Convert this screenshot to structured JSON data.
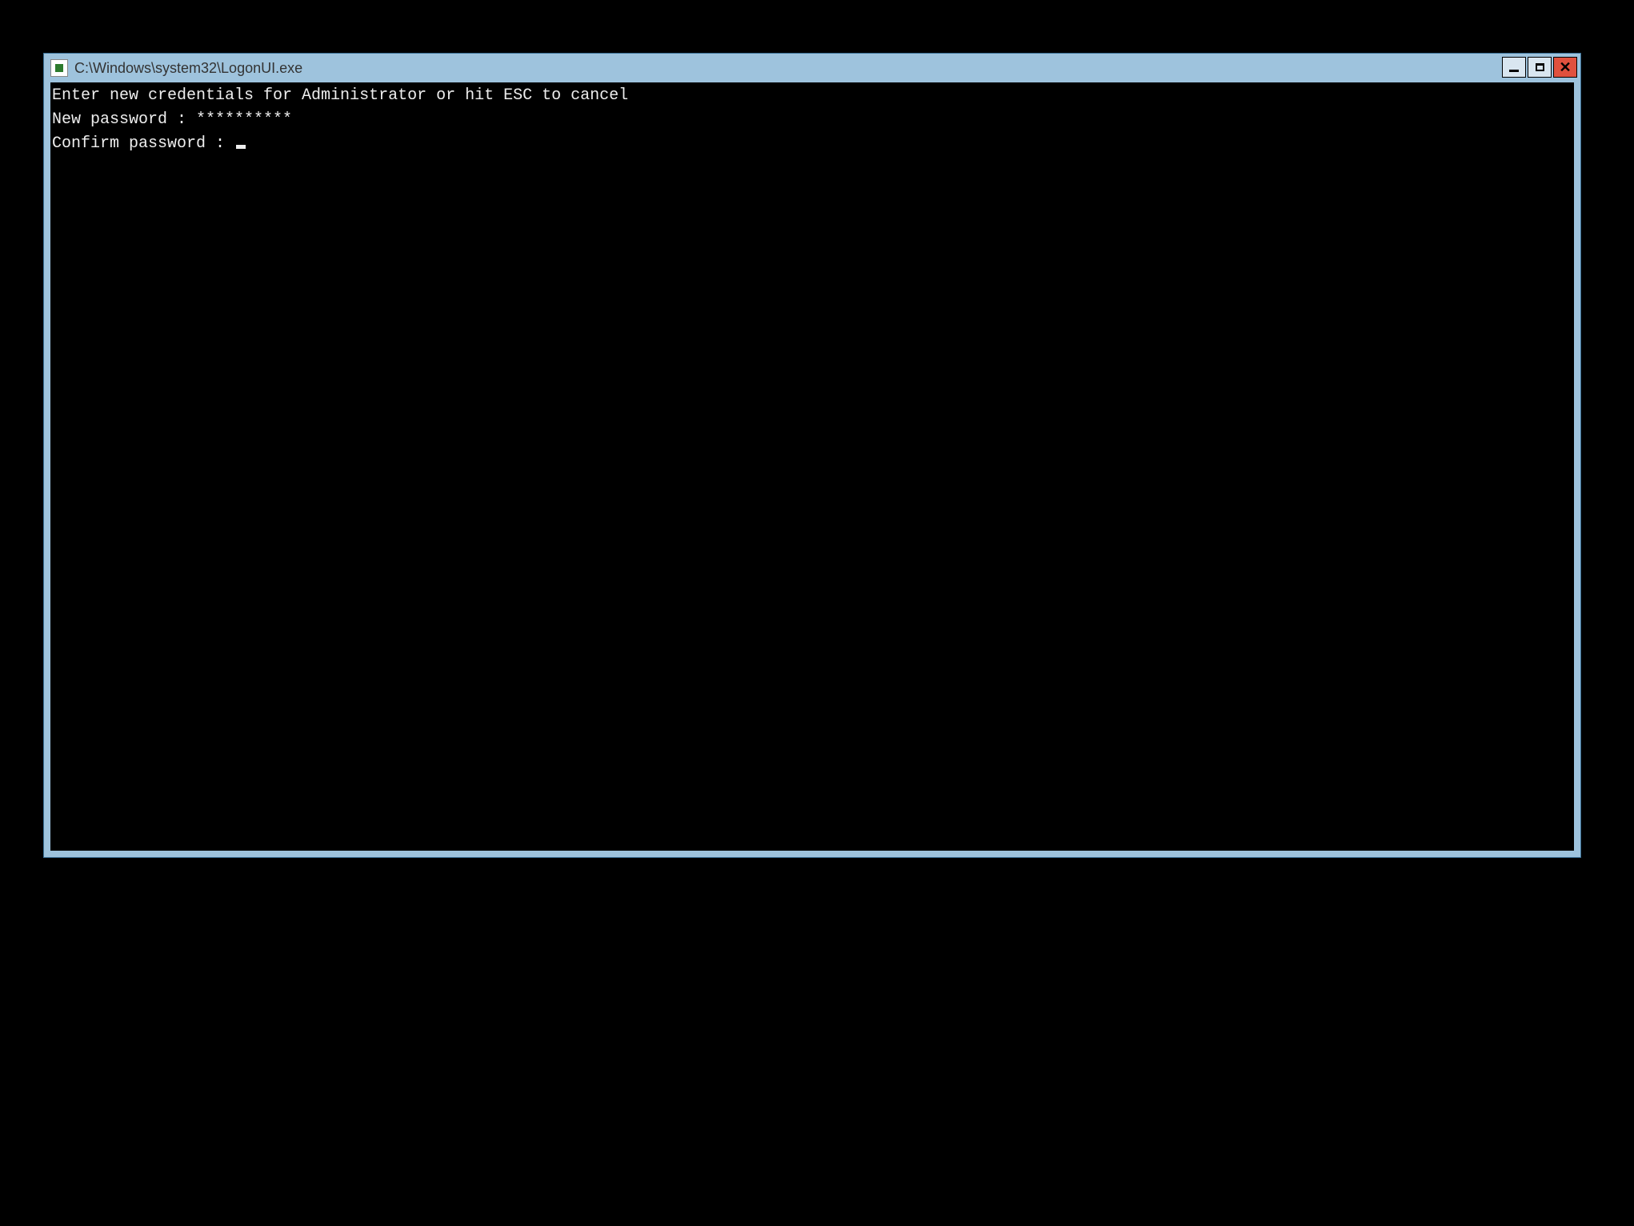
{
  "window": {
    "title": "C:\\Windows\\system32\\LogonUI.exe"
  },
  "console": {
    "line1": "Enter new credentials for Administrator or hit ESC to cancel",
    "line2_label": "New password : ",
    "line2_value": "**********",
    "line3_label": "Confirm password : ",
    "line3_value": ""
  },
  "controls": {
    "close_glyph": "✕"
  }
}
